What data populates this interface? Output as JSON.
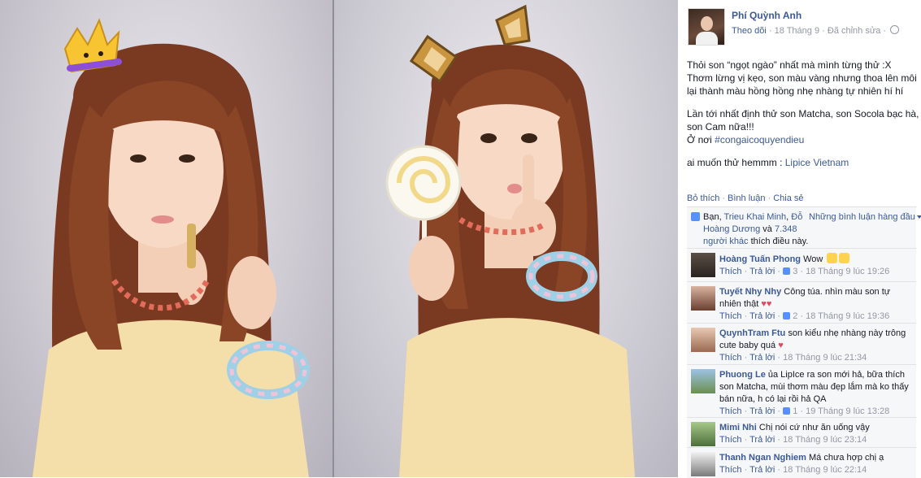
{
  "post": {
    "author": "Phí Quỳnh Anh",
    "follow": "Theo dõi",
    "dot": "·",
    "date": "18 Tháng 9",
    "edited": "Đã chỉnh sửa",
    "text1": "Thỏi son “ngọt ngào” nhất mà mình từng thử :X\nThơm lừng vị kẹo, son màu vàng nhưng thoa lên môi lại thành màu hồng hồng nhẹ nhàng tự nhiên hí hí",
    "text2_a": "Lần tới nhất định thử son Matcha, son Socola bạc hà, son Cam nữa!!!\nỞ nơi ",
    "hashtag": "#congaicoquyendieu",
    "text3_a": "ai muốn thử hemmm : ",
    "mention": "Lipice Vietnam"
  },
  "actions": {
    "like": "Bỏ thích",
    "comment": "Bình luận",
    "share": "Chia sẻ",
    "sep": "·"
  },
  "likes": {
    "prefix": "Bạn, ",
    "name1": "Trieu Khai Minh",
    "comma": ",",
    "name2": "Đỗ Hoàng Dương",
    "and": " và",
    "others": "7.348 người khác",
    "suffix": " thích điều này.",
    "top_comments": "Những bình luận hàng đầu"
  },
  "comments": [
    {
      "name": "Hoàng Tuấn Phong",
      "text": "Wow",
      "reply_label": "Thích",
      "reply": "Trả lời",
      "likes": "3",
      "time": "18 Tháng 9 lúc 19:26"
    },
    {
      "name": "Tuyết Nhy Nhy",
      "text": "Công túa. nhìn màu son tự nhiên thật",
      "reply_label": "Thích",
      "reply": "Trả lời",
      "likes": "2",
      "time": "18 Tháng 9 lúc 19:36"
    },
    {
      "name": "QuynhTram Ftu",
      "text": "son kiểu nhẹ nhàng này trông cute baby quá",
      "reply_label": "Thích",
      "reply": "Trả lời",
      "likes": "",
      "time": "18 Tháng 9 lúc 21:34"
    },
    {
      "name": "Phuong Le",
      "text": "ủa LipIce ra son mới hả, bữa thích son Matcha, mùi thơm màu đẹp lắm mà ko thấy bán nữa, h có lại rồi hả QA",
      "reply_label": "Thích",
      "reply": "Trả lời",
      "likes": "1",
      "time": "19 Tháng 9 lúc 13:28"
    },
    {
      "name": "Mimi Nhi",
      "text": "Chị nói cứ như ăn uống vậy",
      "reply_label": "Thích",
      "reply": "Trả lời",
      "likes": "",
      "time": "18 Tháng 9 lúc 23:14"
    },
    {
      "name": "Thanh Ngan Nghiem",
      "text": "Má chưa hợp chị ạ",
      "reply_label": "Thích",
      "reply": "Trả lời",
      "likes": "",
      "time": "18 Tháng 9 lúc 22:14"
    }
  ]
}
